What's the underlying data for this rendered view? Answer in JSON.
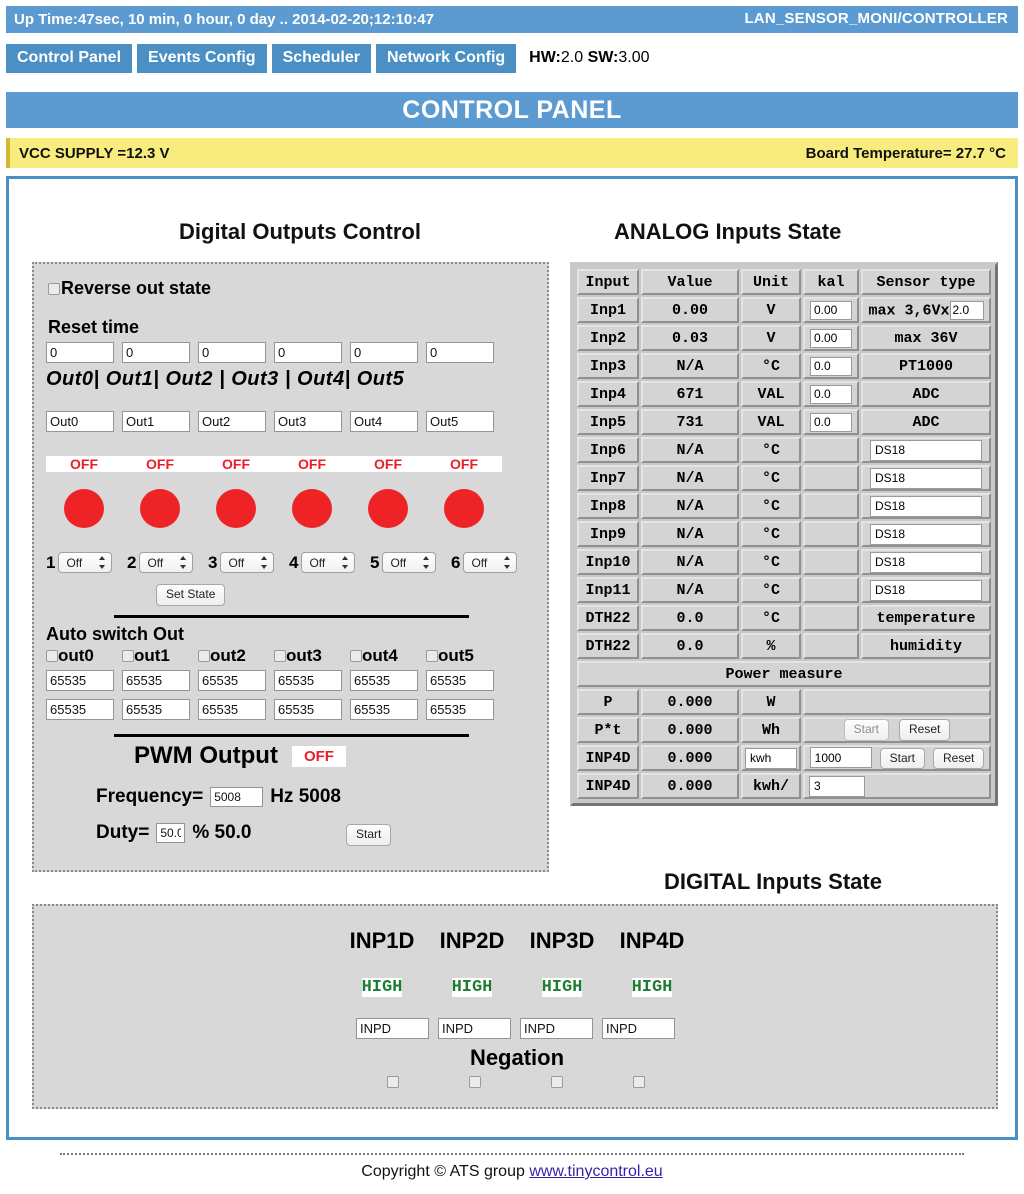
{
  "topbar": {
    "uptime": "Up Time:47sec, 10 min, 0 hour, 0 day .. 2014-02-20;12:10:47",
    "device": "LAN_SENSOR_MONI/CONTROLLER"
  },
  "tabs": [
    {
      "label": "Control Panel"
    },
    {
      "label": "Events Config"
    },
    {
      "label": "Scheduler"
    },
    {
      "label": "Network Config"
    }
  ],
  "version": {
    "hw_label": "HW:",
    "hw": "2.0",
    "sw_label": "SW:",
    "sw": "3.00"
  },
  "page_title": "CONTROL PANEL",
  "supply": {
    "vcc": "VCC SUPPLY =12.3 V",
    "board_temp": "Board Temperature= 27.7 °C"
  },
  "sections": {
    "digital_outputs": "Digital Outputs Control",
    "analog_inputs": "ANALOG Inputs State",
    "digital_inputs": "DIGITAL Inputs State"
  },
  "outputs": {
    "reverse_label": "Reverse out state",
    "reset_time_label": "Reset time",
    "reset_times": [
      "0",
      "0",
      "0",
      "0",
      "0",
      "0"
    ],
    "out_header": [
      "Out0|",
      "Out1|",
      "Out2",
      "|",
      "Out3",
      "|",
      "Out4|",
      "Out5"
    ],
    "names": [
      "Out0",
      "Out1",
      "Out2",
      "Out3",
      "Out4",
      "Out5"
    ],
    "states": [
      "OFF",
      "OFF",
      "OFF",
      "OFF",
      "OFF",
      "OFF"
    ],
    "selector_numbers": [
      "1",
      "2",
      "3",
      "4",
      "5",
      "6"
    ],
    "selector_values": [
      "Off",
      "Off",
      "Off",
      "Off",
      "Off",
      "Off"
    ],
    "set_state_label": "Set State"
  },
  "auto_switch": {
    "title": "Auto switch Out",
    "checkbox_labels": [
      "out0",
      "out1",
      "out2",
      "out3",
      "out4",
      "out5"
    ],
    "row1": [
      "65535",
      "65535",
      "65535",
      "65535",
      "65535",
      "65535"
    ],
    "row2": [
      "65535",
      "65535",
      "65535",
      "65535",
      "65535",
      "65535"
    ]
  },
  "pwm": {
    "title": "PWM Output",
    "state": "OFF",
    "frequency_label": "Frequency=",
    "frequency_value": "5008",
    "frequency_unit": "Hz 5008",
    "duty_label": "Duty=",
    "duty_value": "50.0",
    "duty_unit": "% 50.0",
    "start_label": "Start"
  },
  "analog": {
    "headers": [
      "Input",
      "Value",
      "Unit",
      "kal",
      "Sensor type"
    ],
    "rows": [
      {
        "input": "Inp1",
        "value": "0.00",
        "unit": "V",
        "kal": "0.00",
        "sensor": "max 3,6Vx",
        "sensor_input": "2.0",
        "kal_editable": true,
        "sensor_editable": false
      },
      {
        "input": "Inp2",
        "value": "0.03",
        "unit": "V",
        "kal": "0.00",
        "sensor": "max 36V",
        "kal_editable": true,
        "sensor_editable": false
      },
      {
        "input": "Inp3",
        "value": "N/A",
        "unit": "°C",
        "kal": "0.0",
        "sensor": "PT1000",
        "kal_editable": true,
        "sensor_editable": false
      },
      {
        "input": "Inp4",
        "value": "671",
        "unit": "VAL",
        "kal": "0.0",
        "sensor": "ADC",
        "kal_editable": true,
        "sensor_editable": false
      },
      {
        "input": "Inp5",
        "value": "731",
        "unit": "VAL",
        "kal": "0.0",
        "sensor": "ADC",
        "kal_editable": true,
        "sensor_editable": false
      },
      {
        "input": "Inp6",
        "value": "N/A",
        "unit": "°C",
        "kal": "",
        "sensor": "DS18",
        "kal_editable": false,
        "sensor_editable": true
      },
      {
        "input": "Inp7",
        "value": "N/A",
        "unit": "°C",
        "kal": "",
        "sensor": "DS18",
        "kal_editable": false,
        "sensor_editable": true
      },
      {
        "input": "Inp8",
        "value": "N/A",
        "unit": "°C",
        "kal": "",
        "sensor": "DS18",
        "kal_editable": false,
        "sensor_editable": true
      },
      {
        "input": "Inp9",
        "value": "N/A",
        "unit": "°C",
        "kal": "",
        "sensor": "DS18",
        "kal_editable": false,
        "sensor_editable": true
      },
      {
        "input": "Inp10",
        "value": "N/A",
        "unit": "°C",
        "kal": "",
        "sensor": "DS18",
        "kal_editable": false,
        "sensor_editable": true
      },
      {
        "input": "Inp11",
        "value": "N/A",
        "unit": "°C",
        "kal": "",
        "sensor": "DS18",
        "kal_editable": false,
        "sensor_editable": true
      },
      {
        "input": "DTH22",
        "value": "0.0",
        "unit": "°C",
        "kal": "",
        "sensor": "temperature",
        "kal_editable": false,
        "sensor_editable": false
      },
      {
        "input": "DTH22",
        "value": "0.0",
        "unit": "%",
        "kal": "",
        "sensor": "humidity",
        "kal_editable": false,
        "sensor_editable": false
      }
    ],
    "power_header": "Power measure",
    "power_rows": [
      {
        "input": "P",
        "value": "0.000",
        "unit": "W"
      },
      {
        "input": "P*t",
        "value": "0.000",
        "unit": "Wh"
      },
      {
        "input": "INP4D",
        "value": "0.000",
        "unit": "kwh"
      },
      {
        "input": "INP4D",
        "value": "0.000",
        "unit": "kwh/"
      }
    ],
    "pt_start": "Start",
    "pt_reset": "Reset",
    "inp4d_pulses": "1000",
    "inp4d_start": "Start",
    "inp4d_reset": "Reset",
    "inp4d_divider": "3"
  },
  "digital_inputs": {
    "names": [
      "INP1D",
      "INP2D",
      "INP3D",
      "INP4D"
    ],
    "states": [
      "HIGH",
      "HIGH",
      "HIGH",
      "HIGH"
    ],
    "labels": [
      "INPD",
      "INPD",
      "INPD",
      "INPD"
    ],
    "negation_label": "Negation"
  },
  "footer": {
    "copyright": "Copyright © ATS group ",
    "link": "www.tinycontrol.eu"
  },
  "colors": {
    "accent_blue": "#5b9bd1",
    "tab_blue": "#4a90c4",
    "supply_yellow": "#f7ec7d",
    "off_red": "#ee1c25",
    "led_red": "#ee2326",
    "high_green": "#1e7d32",
    "panel_grey": "#d8d8d8"
  }
}
